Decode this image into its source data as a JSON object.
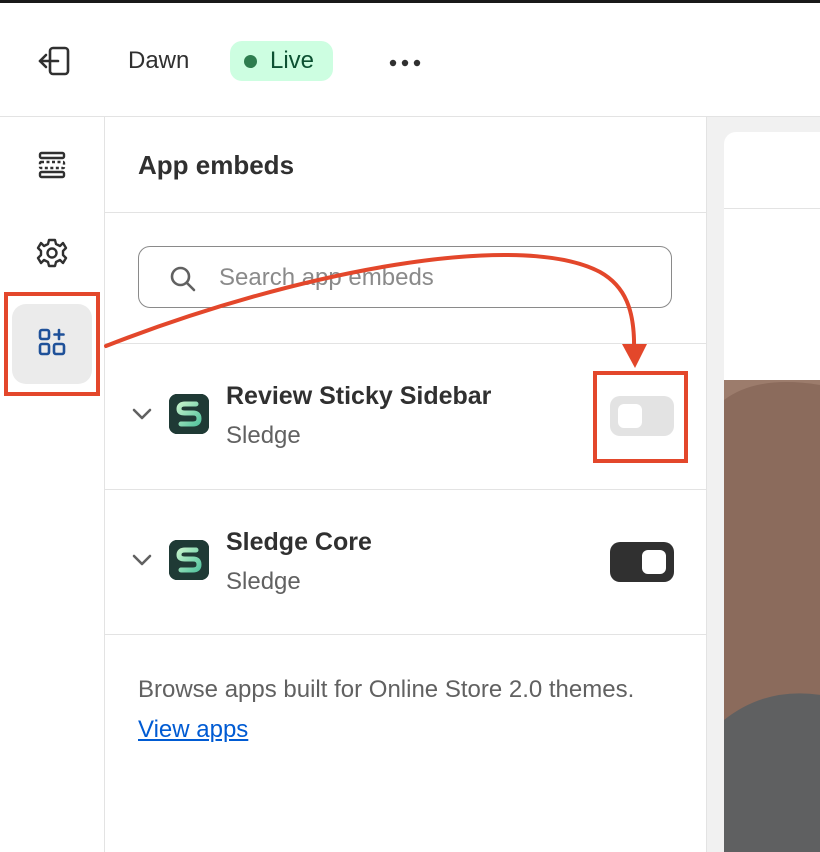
{
  "topbar": {
    "theme_name": "Dawn",
    "status_badge": "Live",
    "icons": {
      "exit": "exit-icon",
      "more": "more-horizontal-icon"
    }
  },
  "rail": {
    "items": [
      {
        "icon": "sections-icon",
        "active": false
      },
      {
        "icon": "gear-icon",
        "active": false
      },
      {
        "icon": "app-embeds-icon",
        "active": true
      }
    ]
  },
  "panel": {
    "title": "App embeds",
    "search": {
      "placeholder": "Search app embeds",
      "value": ""
    },
    "embeds": [
      {
        "name": "Review Sticky Sidebar",
        "vendor": "Sledge",
        "enabled": false
      },
      {
        "name": "Sledge Core",
        "vendor": "Sledge",
        "enabled": true
      }
    ],
    "browse_text": "Browse apps built for Online Store 2.0 themes.",
    "browse_link": "View apps"
  },
  "annotation": {
    "color": "#e3472b"
  },
  "colors": {
    "live_badge_bg": "#cdfee1",
    "live_dot": "#2e7d4f",
    "toggle_on": "#303030",
    "toggle_off": "#e3e3e3",
    "link": "#005bd3"
  }
}
